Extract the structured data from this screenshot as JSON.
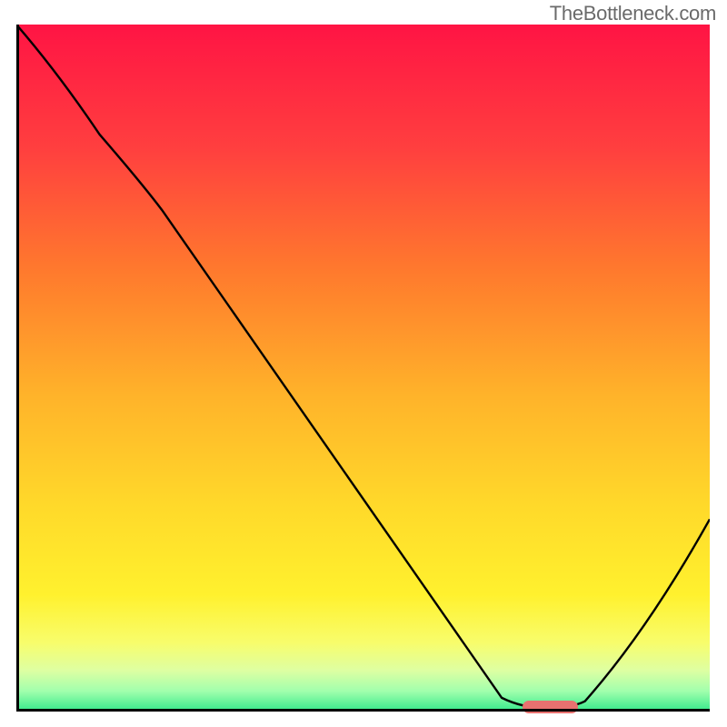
{
  "watermark": "TheBottleneck.com",
  "chart_data": {
    "type": "line",
    "title": "",
    "xlabel": "",
    "ylabel": "",
    "xlim": [
      0,
      100
    ],
    "ylim": [
      0,
      100
    ],
    "grid": false,
    "legend": false,
    "background_gradient_stops": [
      {
        "offset": 0,
        "color": "#ff1444"
      },
      {
        "offset": 0.18,
        "color": "#ff3f3f"
      },
      {
        "offset": 0.36,
        "color": "#ff7a2d"
      },
      {
        "offset": 0.54,
        "color": "#ffb32a"
      },
      {
        "offset": 0.7,
        "color": "#ffd92a"
      },
      {
        "offset": 0.83,
        "color": "#fff12e"
      },
      {
        "offset": 0.9,
        "color": "#f8fd6c"
      },
      {
        "offset": 0.94,
        "color": "#deffa2"
      },
      {
        "offset": 0.97,
        "color": "#a2ffad"
      },
      {
        "offset": 1.0,
        "color": "#34e98b"
      }
    ],
    "series": [
      {
        "name": "bottleneck-curve",
        "type": "line",
        "color": "#000000",
        "points": [
          {
            "x": 0,
            "y": 100
          },
          {
            "x": 12,
            "y": 84
          },
          {
            "x": 21,
            "y": 73
          },
          {
            "x": 70,
            "y": 2
          },
          {
            "x": 73,
            "y": 0.5
          },
          {
            "x": 80,
            "y": 0.5
          },
          {
            "x": 82,
            "y": 1.5
          },
          {
            "x": 100,
            "y": 28
          }
        ]
      }
    ],
    "marker": {
      "name": "optimum-range",
      "x_start": 73,
      "x_end": 81,
      "y": 0.6,
      "color": "#e8716f"
    }
  }
}
